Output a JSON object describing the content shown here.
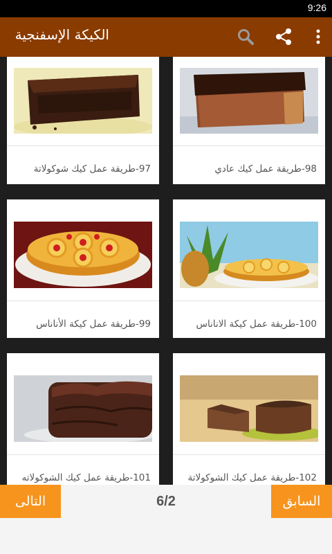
{
  "status_bar": {
    "time": "9:26"
  },
  "app_bar": {
    "title": "الكيكة الإسفنجية",
    "icons": [
      "search-icon",
      "share-icon",
      "more-vert-icon"
    ]
  },
  "recipes": [
    {
      "label": "97-طريقة عمل كيك شوكولاتة",
      "image": "chocolate-frosted-cake"
    },
    {
      "label": "98-طريقة عمل كيك عادي",
      "image": "chocolate-glazed-slice"
    },
    {
      "label": "99-طريقة عمل كيكة الأناناس",
      "image": "pineapple-upside-down-cake"
    },
    {
      "label": "100-طريقة عمل كيكة الاناناس",
      "image": "pineapple-cake-with-pineapple"
    },
    {
      "label": "101-طريقة عمل كيك الشوكولاته",
      "image": "chocolate-layer-cake"
    },
    {
      "label": "102-طريقة عمل كيك الشوكولاتة",
      "image": "sliced-chocolate-sponge"
    }
  ],
  "pagination": {
    "next_label": "التالى",
    "prev_label": "السابق",
    "indicator": "6/2"
  },
  "colors": {
    "app_bar": "#8a3b00",
    "button": "#f7941d",
    "grid_background": "#1e1e1e"
  }
}
